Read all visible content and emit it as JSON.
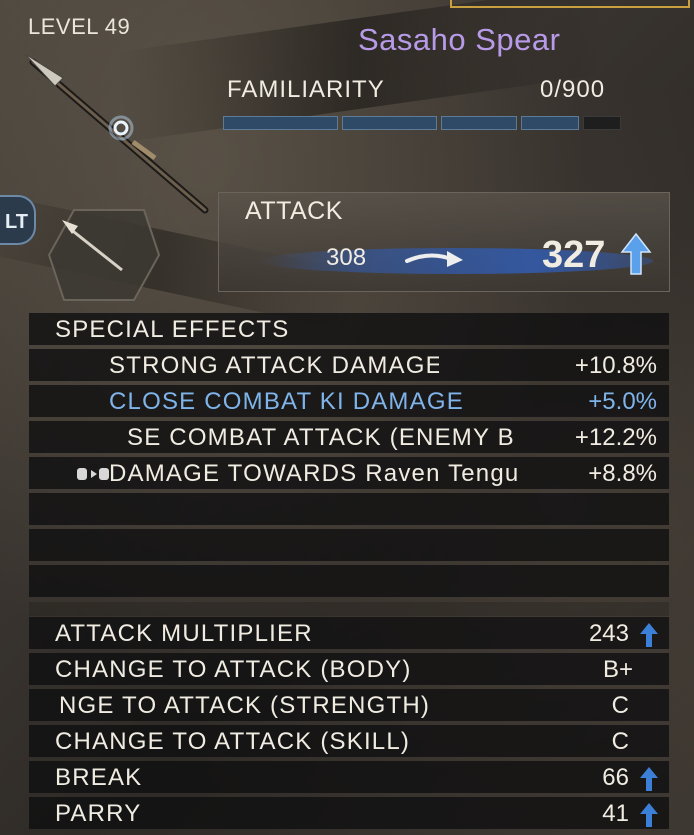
{
  "header": {
    "level": "LEVEL 49",
    "weapon_name": "Sasaho Spear",
    "weapon_name_color": "#b89be8"
  },
  "familiarity": {
    "label": "FAMILIARITY",
    "value": "0/900",
    "segments_total": 5,
    "segments_filled": 4
  },
  "controller_hint": "LT",
  "attack": {
    "label": "ATTACK",
    "old_value": "308",
    "new_value": "327",
    "trend_icon": "up-arrow-icon"
  },
  "special_effects": {
    "title": "SPECIAL EFFECTS",
    "items": [
      {
        "label": "STRONG ATTACK DAMAGE",
        "value": "+10.8%",
        "highlight": false
      },
      {
        "label": "CLOSE COMBAT KI DAMAGE",
        "value": "+5.0%",
        "highlight": true
      },
      {
        "label": "SE COMBAT ATTACK (ENEMY B",
        "value": "+12.2%",
        "highlight": false
      },
      {
        "label": "DAMAGE TOWARDS Raven Tengu",
        "value": "+8.8%",
        "highlight": false,
        "icon": "transfer-icon"
      }
    ],
    "empty_slots": 3
  },
  "stats": [
    {
      "label": "ATTACK MULTIPLIER",
      "value": "243",
      "up": true
    },
    {
      "label": "CHANGE TO ATTACK (BODY)",
      "value": "B+",
      "up": false
    },
    {
      "label": "NGE TO ATTACK (STRENGTH)",
      "value": "C",
      "up": false
    },
    {
      "label": "CHANGE TO ATTACK (SKILL)",
      "value": "C",
      "up": false
    },
    {
      "label": "BREAK",
      "value": "66",
      "up": true
    },
    {
      "label": "PARRY",
      "value": "41",
      "up": true
    }
  ],
  "colors": {
    "highlight_text": "#7fb4ea",
    "up_arrow": "#3b7fd6"
  }
}
